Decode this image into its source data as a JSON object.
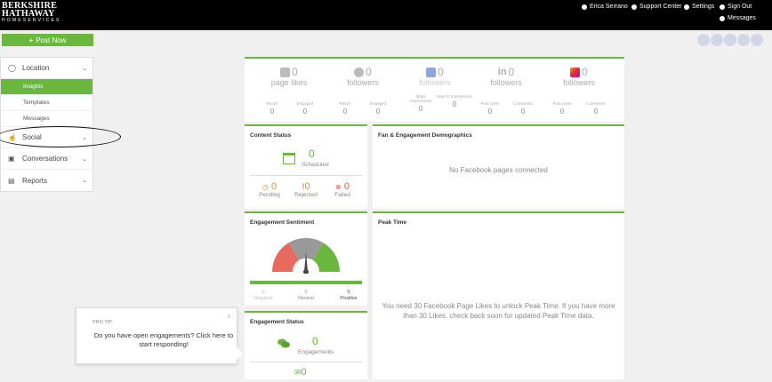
{
  "brand": {
    "line1": "BERKSHIRE",
    "line2": "HATHAWAY",
    "line3": "HOMESERVICES"
  },
  "topnav": {
    "user": "Erica Serrano",
    "support": "Support Center",
    "settings": "Settings",
    "signout": "Sign Out",
    "messages": "Messages"
  },
  "toolbar": {
    "post_now": "Post Now"
  },
  "sidebar": {
    "location": "Location",
    "sub": [
      "Insights",
      "Templates",
      "Messages"
    ],
    "social": "Social",
    "conversations": "Conversations",
    "reports": "Reports"
  },
  "stats": [
    {
      "icon": "facebook-icon",
      "value": "0",
      "label": "page likes",
      "minis": [
        [
          "Reach",
          "0"
        ],
        [
          "Engaged",
          "0"
        ]
      ]
    },
    {
      "icon": "twitter-icon",
      "value": "0",
      "label": "followers",
      "minis": [
        [
          "Reach",
          "0"
        ],
        [
          "Engaged",
          "0"
        ]
      ]
    },
    {
      "icon": "google-my-business-icon",
      "value": "0",
      "label": "followers",
      "minis": [
        [
          "Maps Impressions",
          "0"
        ],
        [
          "Search Impressions",
          "0"
        ]
      ]
    },
    {
      "icon": "linkedin-icon",
      "value": "0",
      "label": "followers",
      "minis": [
        [
          "Post Likes",
          "0"
        ],
        [
          "Comments",
          "0"
        ]
      ]
    },
    {
      "icon": "instagram-icon",
      "value": "0",
      "label": "followers",
      "minis": [
        [
          "Post Likes",
          "0"
        ],
        [
          "Comments",
          "0"
        ]
      ]
    }
  ],
  "content_status": {
    "title": "Content Status",
    "scheduled_value": "0",
    "scheduled_label": "Scheduled",
    "pending_value": "0",
    "pending_label": "Pending",
    "rejected_value": "0",
    "rejected_label": "Rejected",
    "failed_value": "0",
    "failed_label": "Failed"
  },
  "fan_engagement": {
    "title": "Fan & Engagement Demographics",
    "message": "No Facebook pages connected"
  },
  "sentiment": {
    "title": "Engagement Sentiment",
    "negative_value": "0",
    "negative_label": "Negative",
    "neutral_value": "0",
    "neutral_label": "Neutral",
    "positive_value": "0",
    "positive_label": "Positive"
  },
  "peak_time": {
    "title": "Peak Time",
    "message": "You need 30 Facebook Page Likes to unlock Peak Time. If you have more than 30 Likes, check back soon for updated Peak Time data."
  },
  "engagement_status": {
    "title": "Engagement Status",
    "engagements_value": "0",
    "engagements_label": "Engagements",
    "bottom_value": "0"
  },
  "tip": {
    "label": "PRO TIP",
    "text": "Do you have open engagements? Click here to start responding!",
    "close": "×"
  },
  "colors": {
    "accent": "#6ab73f",
    "negative": "#e86a5f",
    "neutral": "#999999",
    "positive": "#6ab73f",
    "orange": "#e8893a",
    "red": "#e05a4f"
  }
}
